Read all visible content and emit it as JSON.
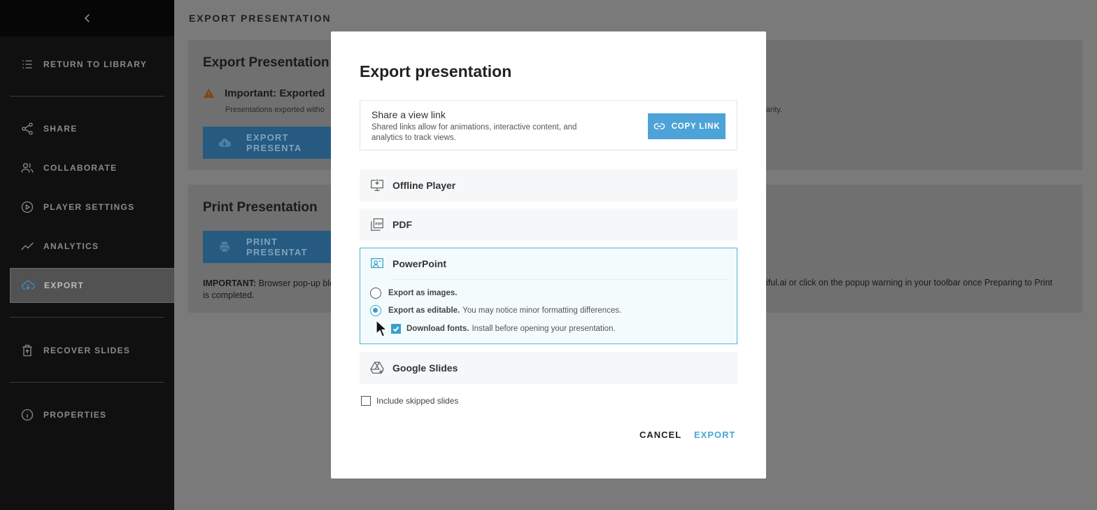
{
  "sidebar": {
    "items": [
      {
        "label": "RETURN TO LIBRARY",
        "icon": "list-icon"
      },
      {
        "label": "SHARE",
        "icon": "share-icon"
      },
      {
        "label": "COLLABORATE",
        "icon": "users-icon"
      },
      {
        "label": "PLAYER SETTINGS",
        "icon": "play-circle-icon"
      },
      {
        "label": "ANALYTICS",
        "icon": "trend-icon"
      },
      {
        "label": "EXPORT",
        "icon": "cloud-download-icon",
        "active": true
      },
      {
        "label": "RECOVER SLIDES",
        "icon": "trash-restore-icon"
      },
      {
        "label": "PROPERTIES",
        "icon": "info-icon"
      }
    ]
  },
  "main": {
    "page_title": "EXPORT PRESENTATION",
    "export_card": {
      "title": "Export Presentation",
      "warning_title": "Important: Exported",
      "warning_sub_left": "Presentations exported witho",
      "warning_sub_right": "arity.",
      "button_label": "EXPORT PRESENTA"
    },
    "print_card": {
      "title": "Print Presentation",
      "button_label": "PRINT PRESENTAT",
      "note_bold": "IMPORTANT:",
      "note_left": " Browser pop-up blo",
      "note_left_2": "is completed.",
      "note_right": "iful.ai or click on the popup warning in your toolbar once Preparing to Print"
    }
  },
  "modal": {
    "title": "Export presentation",
    "share": {
      "title": "Share a view link",
      "desc": "Shared links allow for animations, interactive content, and analytics to track views.",
      "copy_label": "COPY LINK"
    },
    "options": [
      {
        "label": "Offline Player",
        "icon": "monitor-download-icon"
      },
      {
        "label": "PDF",
        "icon": "pdf-icon"
      },
      {
        "label": "PowerPoint",
        "icon": "presenter-icon",
        "selected": true
      },
      {
        "label": "Google Slides",
        "icon": "drive-icon"
      }
    ],
    "powerpoint": {
      "images_label": "Export as images.",
      "editable_label": "Export as editable.",
      "editable_note": "You may notice minor formatting differences.",
      "fonts_label": "Download fonts.",
      "fonts_note": "Install before opening your presentation."
    },
    "skip_label": "Include skipped slides",
    "cancel_label": "CANCEL",
    "export_label": "EXPORT"
  },
  "colors": {
    "accent": "#4da3d8",
    "sidebar_bg": "#101010",
    "overlay": "#7a7a7a"
  }
}
